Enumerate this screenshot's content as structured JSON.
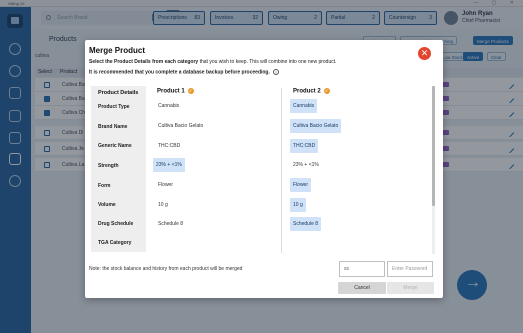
{
  "window": {
    "title": "Viking 10"
  },
  "search": {
    "placeholder": "Search Brand"
  },
  "topbar": {
    "buttons": [
      {
        "label": "Prescriptions",
        "count": "83"
      },
      {
        "label": "Invoices",
        "count": "32"
      },
      {
        "label": "Owing",
        "count": "2"
      },
      {
        "label": "Partial",
        "count": "2"
      },
      {
        "label": "Countersign",
        "count": "3"
      }
    ],
    "user_name": "John Ryan",
    "user_role": "Chief Pharmacist"
  },
  "background": {
    "page_title": "Products",
    "buttons": [
      "Add Product",
      "Import Product Matching",
      "Merge Products",
      "Low Stock",
      "Active",
      "Clear"
    ],
    "filter_value": "cultiva",
    "table_headers": [
      "Select",
      "Product"
    ],
    "rows": [
      {
        "name": "Cultiva Ba",
        "checked": false
      },
      {
        "name": "Cultiva Ba",
        "checked": true
      },
      {
        "name": "Cultiva Ch",
        "checked": true
      },
      {
        "name": "Cultiva Di",
        "checked": false
      },
      {
        "name": "Cultiva Je",
        "checked": false
      },
      {
        "name": "Cultiva La",
        "checked": false
      }
    ]
  },
  "modal": {
    "title": "Merge Product",
    "desc1_bold": "Select the Product Details from each category",
    "desc1_rest": " that you wish to keep. This will combine into one new product.",
    "desc2": "It is recommended that you complete a database backup before proceeding.",
    "details_header": "Product Details",
    "labels": [
      "Product Type",
      "Brand Name",
      "Generic Name",
      "Strength",
      "Form",
      "Volume",
      "Drug Schedule",
      "TGA Category"
    ],
    "product1": {
      "header": "Product 1",
      "values": [
        "Cannabis",
        "Cultiva Bacio Gelato",
        "THC:CBD",
        "23% + <1%",
        "Flower",
        "10 g",
        "Schedule 8",
        ""
      ],
      "selected": [
        false,
        false,
        false,
        true,
        false,
        false,
        false,
        false
      ]
    },
    "product2": {
      "header": "Product 2",
      "values": [
        "Cannabis",
        "Cultiva Bacio Gelato",
        "THC:CBD",
        "23% + <1%",
        "Flower",
        "10 g",
        "Schedule 8",
        ""
      ],
      "selected": [
        true,
        true,
        true,
        false,
        true,
        true,
        true,
        false
      ]
    },
    "note": "Note: the stock balance and history from each product will be merged",
    "pin_value": "ss",
    "password_placeholder": "Enter Password",
    "cancel_label": "Cancel",
    "merge_label": "Merge"
  },
  "colors": {
    "sidebar": "#1f5f9c",
    "close": "#e4452f",
    "selected_value": "#cfe2f7",
    "badge": "#e89a2b"
  }
}
